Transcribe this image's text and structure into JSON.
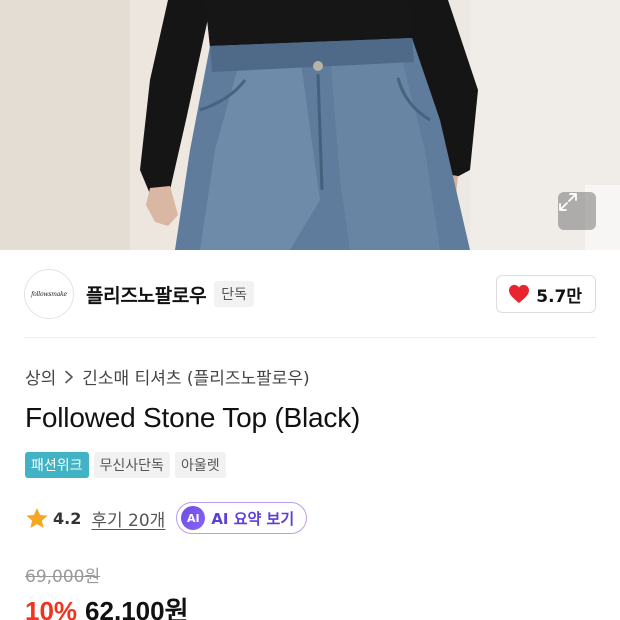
{
  "brand": {
    "logo_text": "followsmake",
    "name": "플리즈노팔로우",
    "badge": "단독",
    "likes": "5.7만"
  },
  "breadcrumb": [
    "상의",
    "긴소매 티셔츠 (플리즈노팔로우)"
  ],
  "product": {
    "title": "Followed Stone Top (Black)"
  },
  "tags": [
    "패션위크",
    "무신사단독",
    "아울렛"
  ],
  "rating": {
    "score": "4.2",
    "reviews": "후기 20개",
    "ai_badge": "AI",
    "ai_label": "AI 요약 보기"
  },
  "price": {
    "original": "69,000원",
    "discount": "10%",
    "sale": "62,100원"
  },
  "colors": {
    "heart": "#e8242f",
    "star": "#f5a623",
    "discount": "#f2331f",
    "tag_highlight": "#42b2c5",
    "ai_accent": "#6d4de6"
  },
  "icons": {
    "expand": "expand-icon",
    "like": "heart-icon",
    "rating": "star-icon",
    "breadcrumb_separator": "chevron-right-icon"
  }
}
